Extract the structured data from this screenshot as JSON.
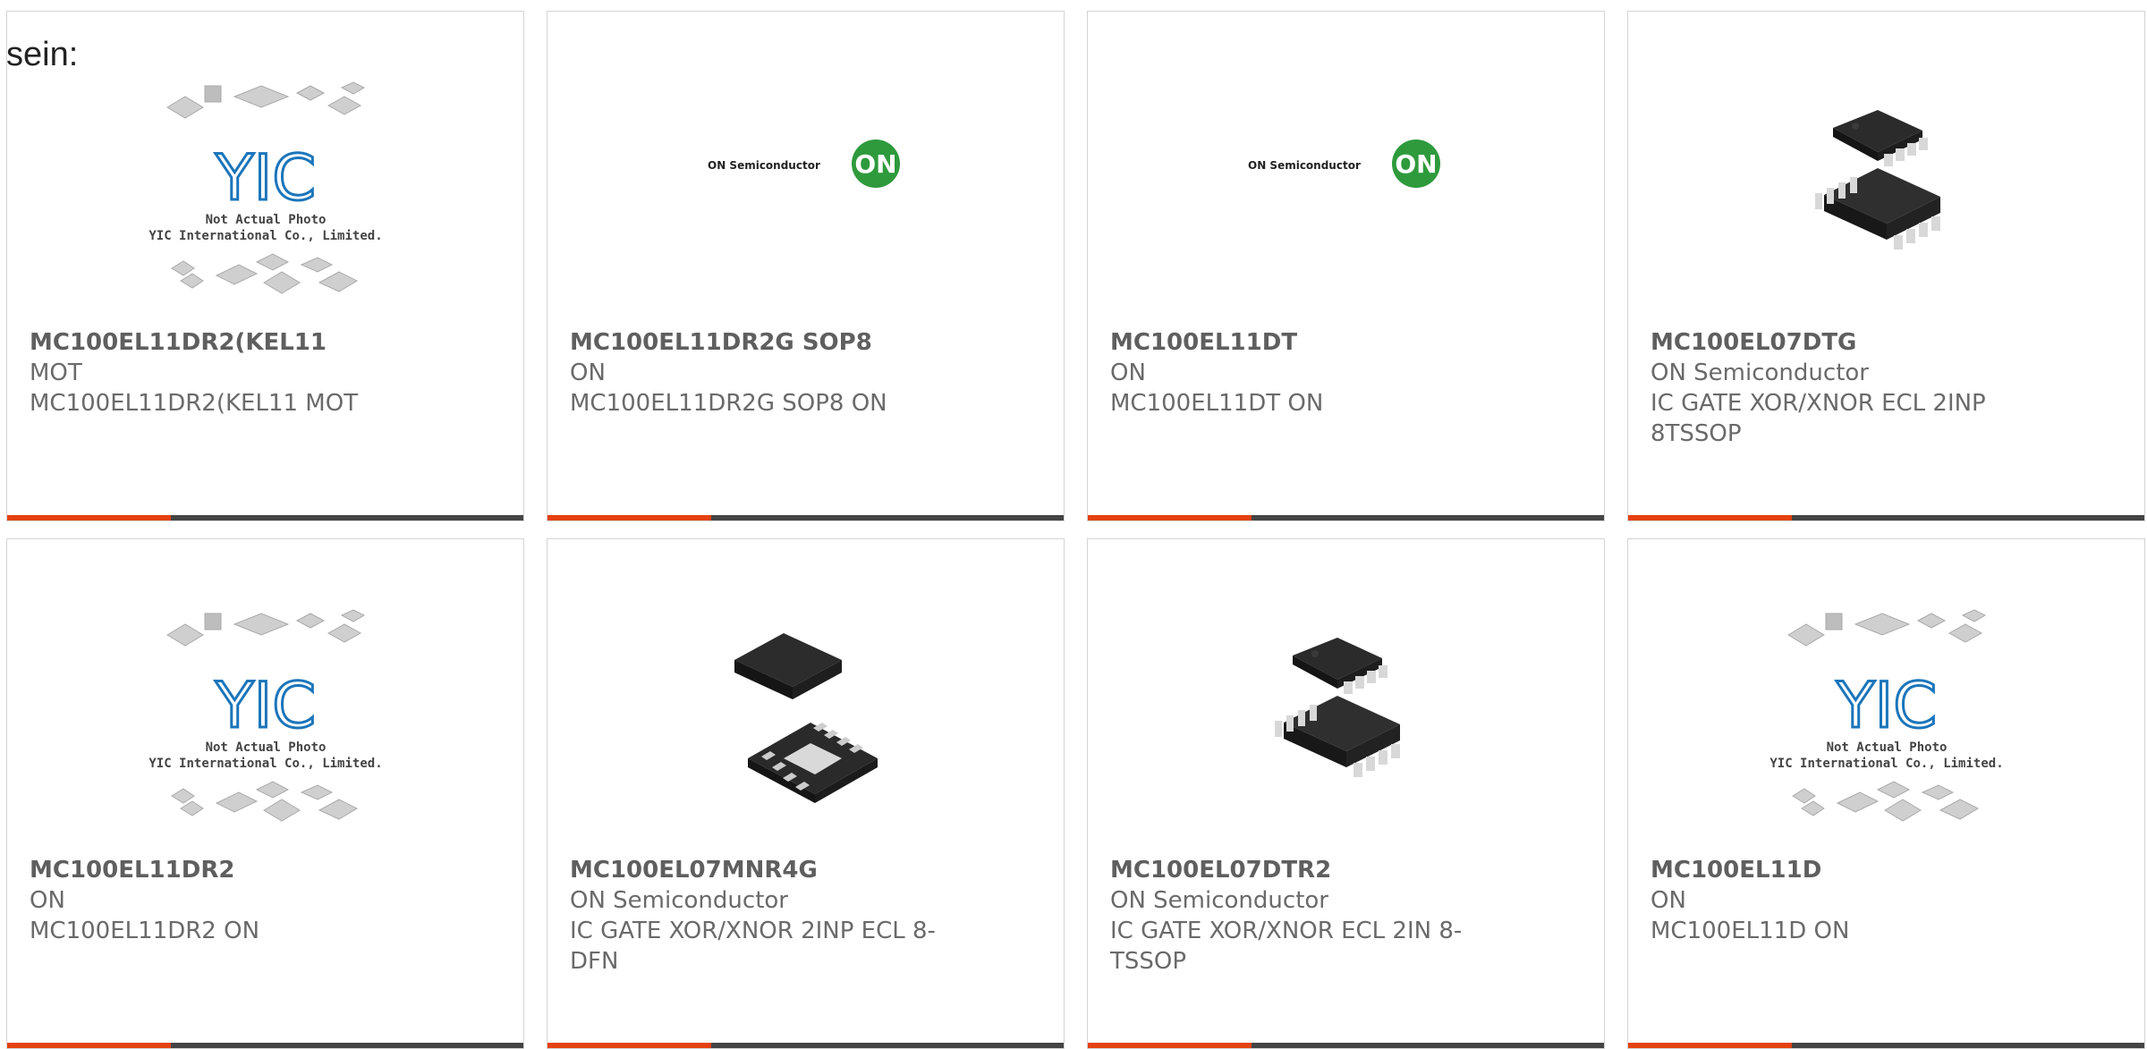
{
  "intro_text": "sein:",
  "colors": {
    "accent": "#e4410f",
    "bar": "#444444",
    "on_green": "#2e9a3c",
    "yic_blue": "#1b75bb"
  },
  "placeholder_caption": {
    "line1": "Not Actual Photo",
    "line2": "YIC International Co., Limited.",
    "logo": "YIC"
  },
  "on_logo": {
    "company": "ON Semiconductor",
    "badge": "ON"
  },
  "cards": [
    {
      "image": "yic-placeholder",
      "title": "MC100EL11DR2(KEL11",
      "maker": "MOT",
      "desc": "MC100EL11DR2(KEL11 MOT"
    },
    {
      "image": "on-semi-logo",
      "title": "MC100EL11DR2G SOP8",
      "maker": "ON",
      "desc": "MC100EL11DR2G SOP8 ON"
    },
    {
      "image": "on-semi-logo",
      "title": "MC100EL11DT",
      "maker": "ON",
      "desc": "MC100EL11DT ON"
    },
    {
      "image": "tssop-chip-photo",
      "title": "MC100EL07DTG",
      "maker": "ON Semiconductor",
      "desc": "IC GATE XOR/XNOR ECL 2INP 8TSSOP"
    },
    {
      "image": "yic-placeholder",
      "title": "MC100EL11DR2",
      "maker": "ON",
      "desc": "MC100EL11DR2 ON"
    },
    {
      "image": "dfn-chip-photo",
      "title": "MC100EL07MNR4G",
      "maker": "ON Semiconductor",
      "desc": "IC GATE XOR/XNOR 2INP ECL 8-DFN"
    },
    {
      "image": "tssop-chip-photo",
      "title": "MC100EL07DTR2",
      "maker": "ON Semiconductor",
      "desc": "IC GATE XOR/XNOR ECL 2IN 8-TSSOP"
    },
    {
      "image": "yic-placeholder",
      "title": "MC100EL11D",
      "maker": "ON",
      "desc": "MC100EL11D ON"
    }
  ]
}
